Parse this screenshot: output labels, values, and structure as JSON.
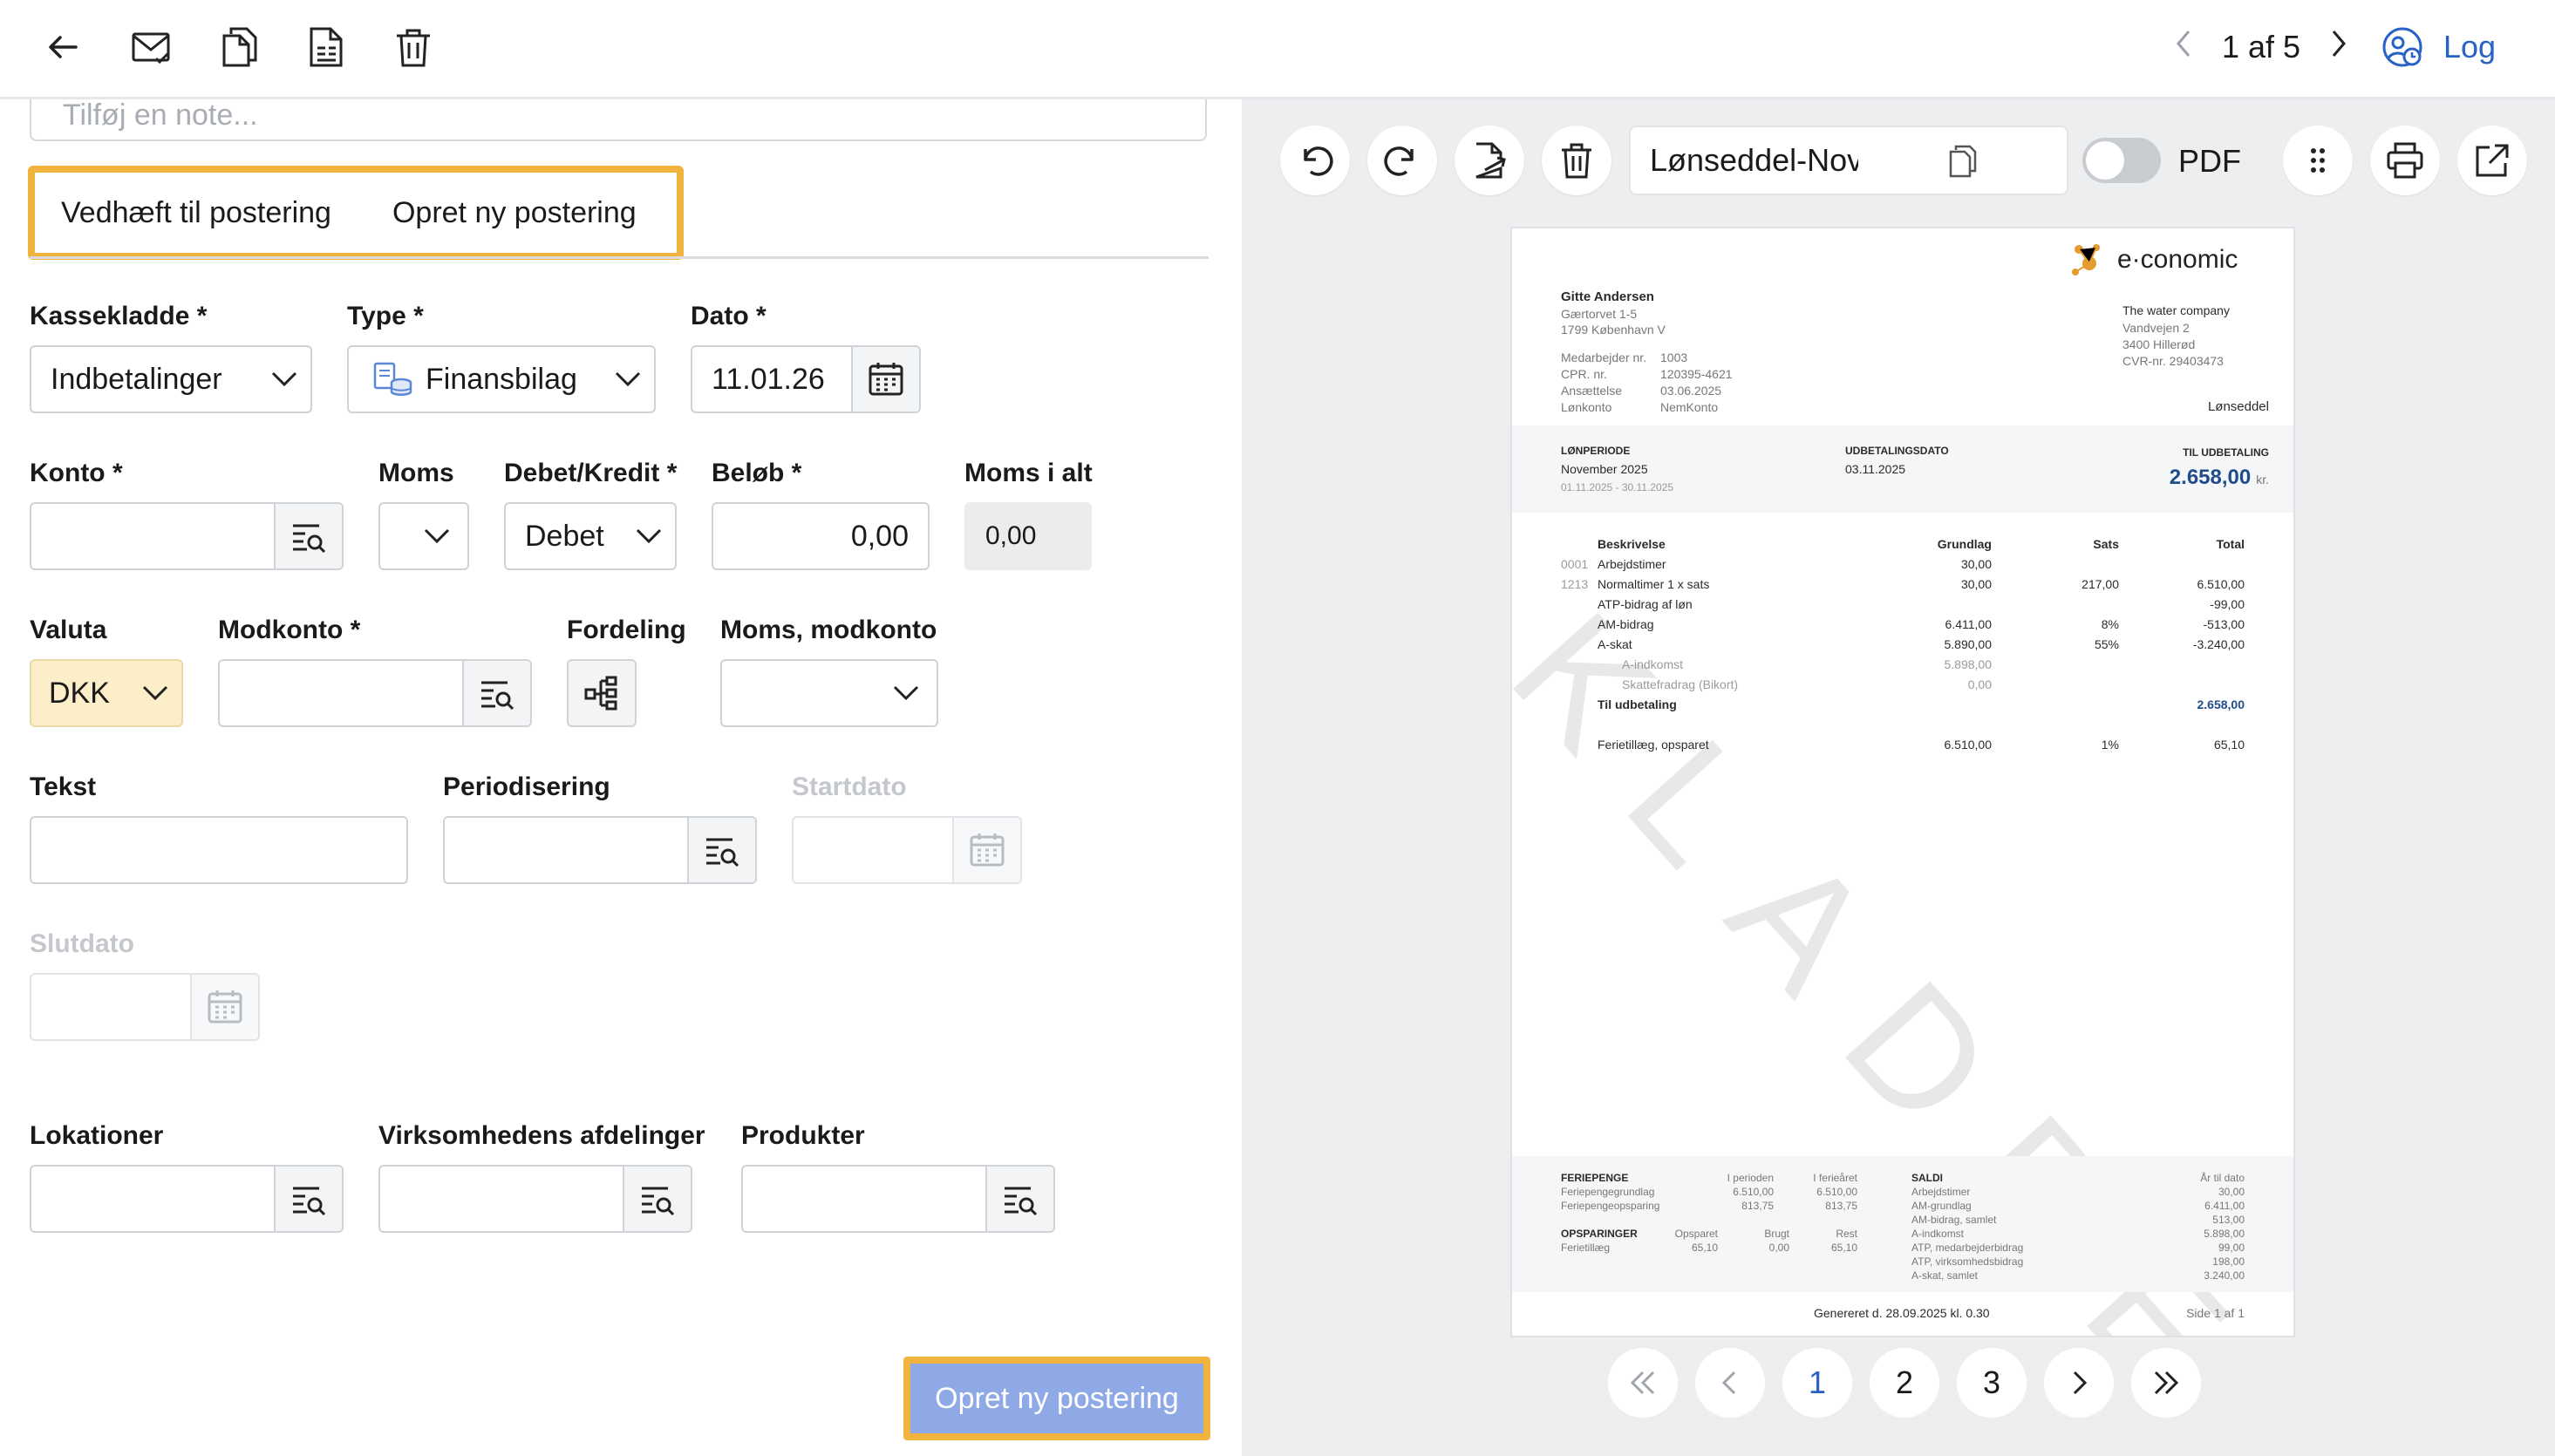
{
  "topbar": {
    "icons": [
      "back-arrow-icon",
      "mail-icon",
      "copy-icon",
      "document-lines-icon",
      "trash-icon"
    ],
    "pager_text": "1 af 5",
    "log_label": "Log"
  },
  "left": {
    "note_placeholder": "Tilføj en note...",
    "tabs": [
      "Vedhæft til postering",
      "Opret ny postering"
    ],
    "labels": {
      "kassekladde": "Kassekladde *",
      "type": "Type *",
      "dato": "Dato *",
      "konto": "Konto *",
      "moms": "Moms",
      "debet_kredit": "Debet/Kredit *",
      "belob": "Beløb *",
      "moms_i_alt": "Moms i alt",
      "valuta": "Valuta",
      "modkonto": "Modkonto *",
      "fordeling": "Fordeling",
      "moms_modkonto": "Moms, modkonto",
      "tekst": "Tekst",
      "periodisering": "Periodisering",
      "startdato": "Startdato",
      "slutdato": "Slutdato",
      "lokationer": "Lokationer",
      "afdelinger": "Virksomhedens afdelinger",
      "produkter": "Produkter"
    },
    "values": {
      "kassekladde": "Indbetalinger",
      "type": "Finansbilag",
      "dato": "11.01.26",
      "konto": "",
      "moms": "",
      "debet_kredit": "Debet",
      "belob": "0,00",
      "moms_i_alt": "0,00",
      "valuta": "DKK",
      "modkonto": "",
      "moms_modkonto": "",
      "tekst": "",
      "periodisering": "",
      "startdato": "",
      "slutdato": "",
      "lokationer": "",
      "afdelinger": "",
      "produkter": ""
    },
    "submit_label": "Opret ny postering"
  },
  "viewer": {
    "icons": [
      "undo-icon",
      "redo-icon",
      "export-file-icon",
      "trash-icon",
      "copy-icon",
      "drag-handle-icon",
      "print-icon",
      "open-external-icon"
    ],
    "file_name": "Lønseddel-November ...",
    "pdf_label": "PDF",
    "pdf_toggle_on": false,
    "pages": [
      "1",
      "2",
      "3"
    ],
    "active_page": "1"
  },
  "document": {
    "watermark": "KLADDE",
    "brand": "e·conomic",
    "employee_name": "Gitte Andersen",
    "employee_address1": "Gærtorvet 1-5",
    "employee_address2": "1799 København V",
    "company_name": "The water company",
    "company_address1": "Vandvejen 2",
    "company_address2": "3400 Hillerød",
    "company_cvr": "CVR-nr. 29403473",
    "doc_type": "Lønseddel",
    "meta": [
      {
        "k": "Medarbejder nr.",
        "v": "1003"
      },
      {
        "k": "CPR. nr.",
        "v": "120395-4621"
      },
      {
        "k": "Ansættelse",
        "v": "03.06.2025"
      },
      {
        "k": "Lønkonto",
        "v": "NemKonto"
      }
    ],
    "lonperiode_label": "LØNPERIODE",
    "lonperiode_value": "November 2025",
    "lonperiode_range": "01.11.2025 - 30.11.2025",
    "udbetalingsdato_label": "UDBETALINGSDATO",
    "udbetalingsdato_value": "03.11.2025",
    "til_udbetaling_label": "TIL UDBETALING",
    "til_udbetaling_value": "2.658,00",
    "til_udbetaling_unit": "kr.",
    "columns": [
      "Beskrivelse",
      "Grundlag",
      "Sats",
      "Total"
    ],
    "rows": [
      {
        "code": "0001",
        "desc": "Arbejdstimer",
        "grundlag": "30,00",
        "sats": "",
        "total": ""
      },
      {
        "code": "1213",
        "desc": "Normaltimer 1 x sats",
        "grundlag": "30,00",
        "sats": "217,00",
        "total": "6.510,00"
      },
      {
        "code": "",
        "desc": "ATP-bidrag af løn",
        "grundlag": "",
        "sats": "",
        "total": "-99,00"
      },
      {
        "code": "",
        "desc": "AM-bidrag",
        "grundlag": "6.411,00",
        "sats": "8%",
        "total": "-513,00"
      },
      {
        "code": "",
        "desc": "A-skat",
        "grundlag": "5.890,00",
        "sats": "55%",
        "total": "-3.240,00"
      },
      {
        "code": "",
        "desc": "A-indkomst",
        "grundlag": "5.898,00",
        "sats": "",
        "total": ""
      },
      {
        "code": "",
        "desc": "Skattefradrag (Bikort)",
        "grundlag": "0,00",
        "sats": "",
        "total": ""
      },
      {
        "code": "",
        "desc": "Til udbetaling",
        "grundlag": "",
        "sats": "",
        "total": "2.658,00"
      },
      {
        "code": "",
        "desc": "Ferietillæg, opsparet",
        "grundlag": "6.510,00",
        "sats": "1%",
        "total": "65,10"
      }
    ],
    "footer": {
      "feriepenge_label": "FERIEPENGE",
      "i_perioden": "I perioden",
      "i_ferieaaret": "I ferieåret",
      "saldi_label": "SALDI",
      "aar_til_dato": "År til dato",
      "fp_rows": [
        {
          "k": "Feriepengegrundlag",
          "a": "6.510,00",
          "b": "6.510,00"
        },
        {
          "k": "Feriepengeopsparing",
          "a": "813,75",
          "b": "813,75"
        }
      ],
      "saldi_rows": [
        {
          "k": "Arbejdstimer",
          "v": "30,00"
        },
        {
          "k": "AM-grundlag",
          "v": "6.411,00"
        },
        {
          "k": "AM-bidrag, samlet",
          "v": "513,00"
        },
        {
          "k": "A-indkomst",
          "v": "5.898,00"
        },
        {
          "k": "ATP, medarbejderbidrag",
          "v": "99,00"
        },
        {
          "k": "ATP, virksomhedsbidrag",
          "v": "198,00"
        },
        {
          "k": "A-skat, samlet",
          "v": "3.240,00"
        }
      ],
      "opsparinger_label": "OPSPARINGER",
      "opsparet": "Opsparet",
      "brugt": "Brugt",
      "rest": "Rest",
      "op_row": {
        "k": "Ferietillæg",
        "a": "65,10",
        "b": "0,00",
        "c": "65,10"
      },
      "generated": "Genereret d. 28.09.2025 kl. 0.30",
      "side": "Side 1 af 1"
    }
  }
}
